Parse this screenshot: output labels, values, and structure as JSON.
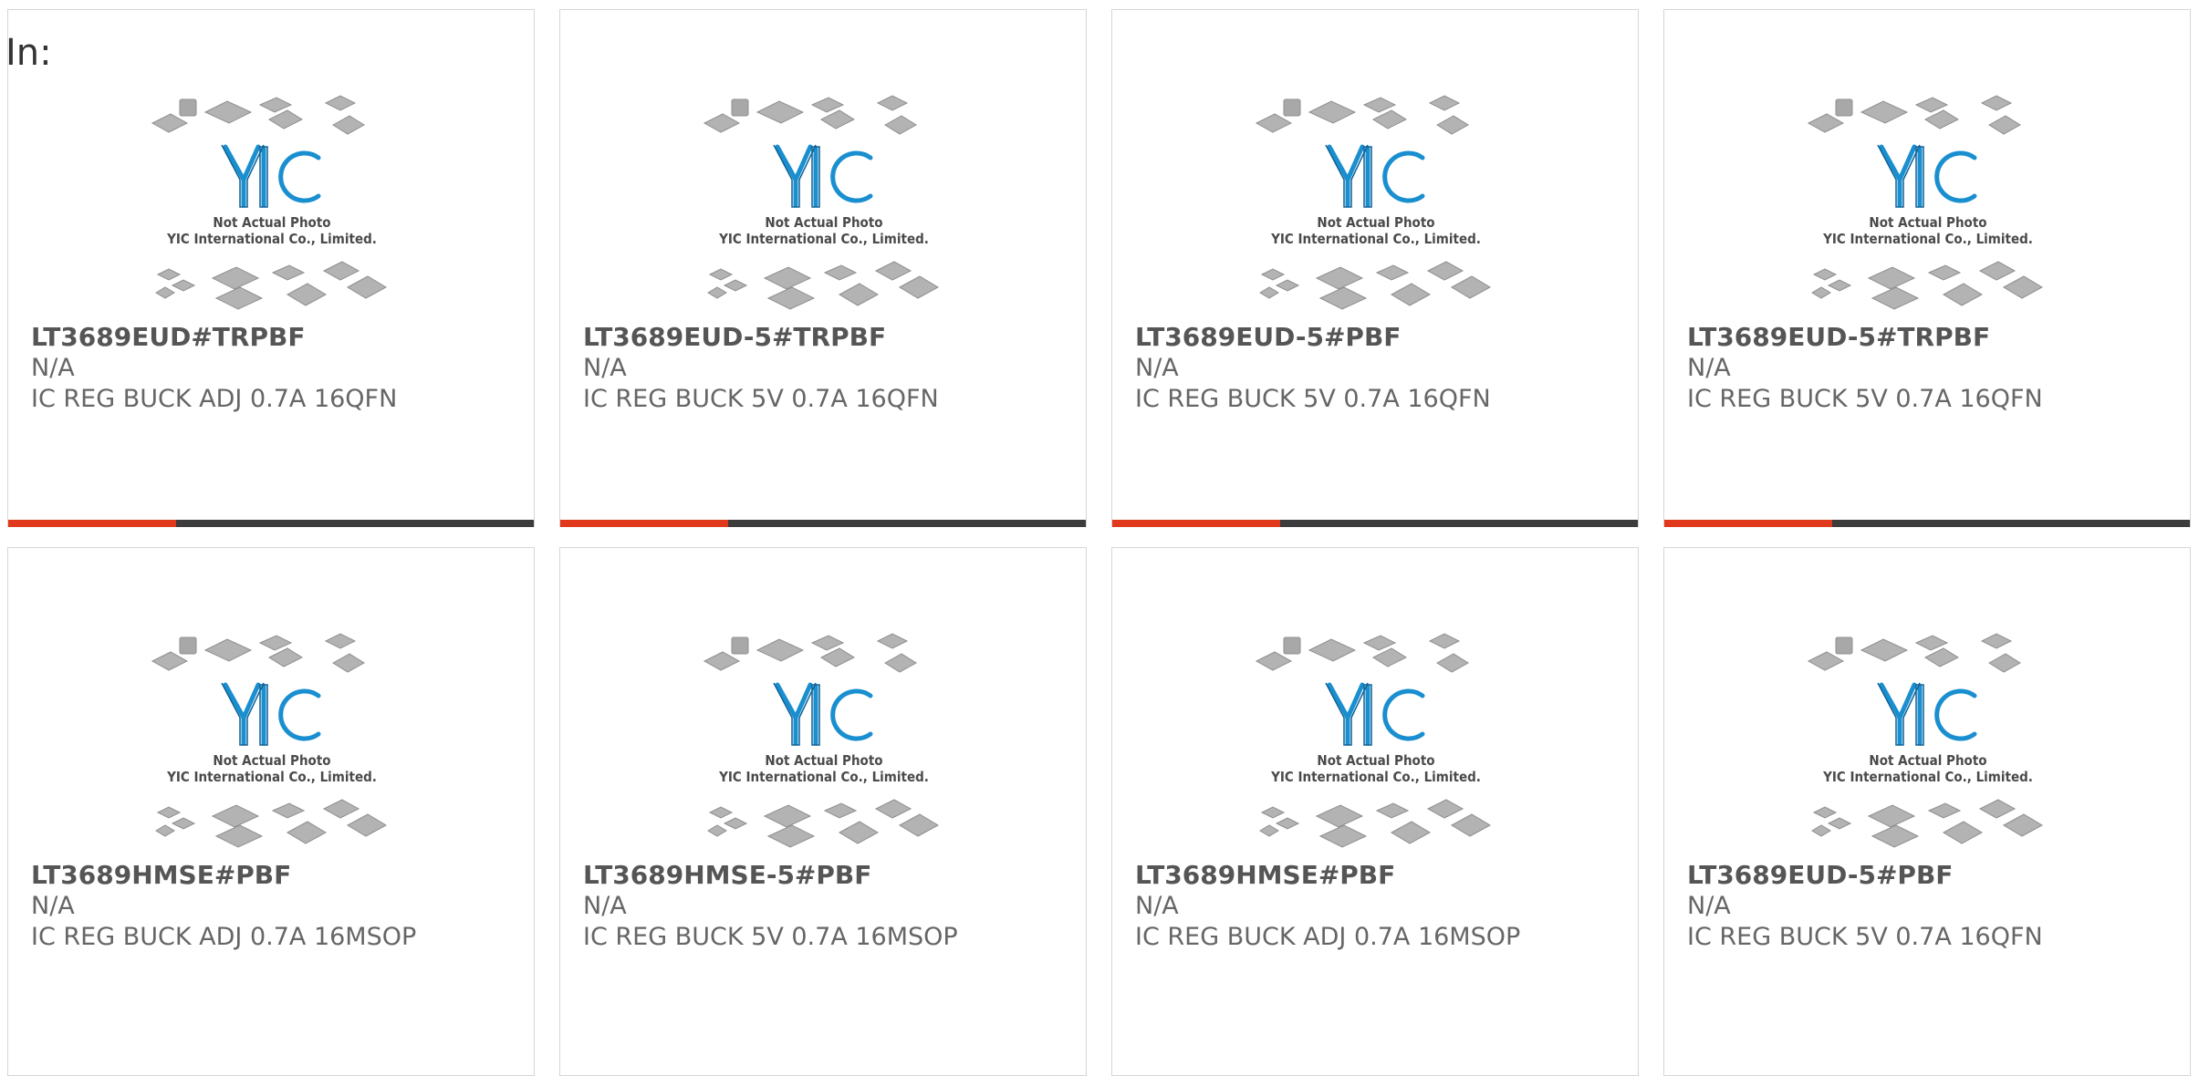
{
  "header": {
    "label": "In:"
  },
  "placeholder_image": {
    "logo_text": "YIC",
    "caption_line1": "Not Actual Photo",
    "caption_line2": "YIC International Co., Limited."
  },
  "colors": {
    "accent": "#e0391c",
    "track": "#3c3c3c",
    "logo": "#1a8fd0",
    "chip": "#a9a9a9"
  },
  "products": [
    {
      "part": "LT3689EUD#TRPBF",
      "manufacturer": "N/A",
      "description": "IC REG BUCK ADJ 0.7A 16QFN",
      "progress": 0.32
    },
    {
      "part": "LT3689EUD-5#TRPBF",
      "manufacturer": "N/A",
      "description": "IC REG BUCK 5V 0.7A 16QFN",
      "progress": 0.32
    },
    {
      "part": "LT3689EUD-5#PBF",
      "manufacturer": "N/A",
      "description": "IC REG BUCK 5V 0.7A 16QFN",
      "progress": 0.32
    },
    {
      "part": "LT3689EUD-5#TRPBF",
      "manufacturer": "N/A",
      "description": "IC REG BUCK 5V 0.7A 16QFN",
      "progress": 0.32
    },
    {
      "part": "LT3689HMSE#PBF",
      "manufacturer": "N/A",
      "description": "IC REG BUCK ADJ 0.7A 16MSOP"
    },
    {
      "part": "LT3689HMSE-5#PBF",
      "manufacturer": "N/A",
      "description": "IC REG BUCK 5V 0.7A 16MSOP"
    },
    {
      "part": "LT3689HMSE#PBF",
      "manufacturer": "N/A",
      "description": "IC REG BUCK ADJ 0.7A 16MSOP"
    },
    {
      "part": "LT3689EUD-5#PBF",
      "manufacturer": "N/A",
      "description": "IC REG BUCK 5V 0.7A 16QFN"
    }
  ]
}
